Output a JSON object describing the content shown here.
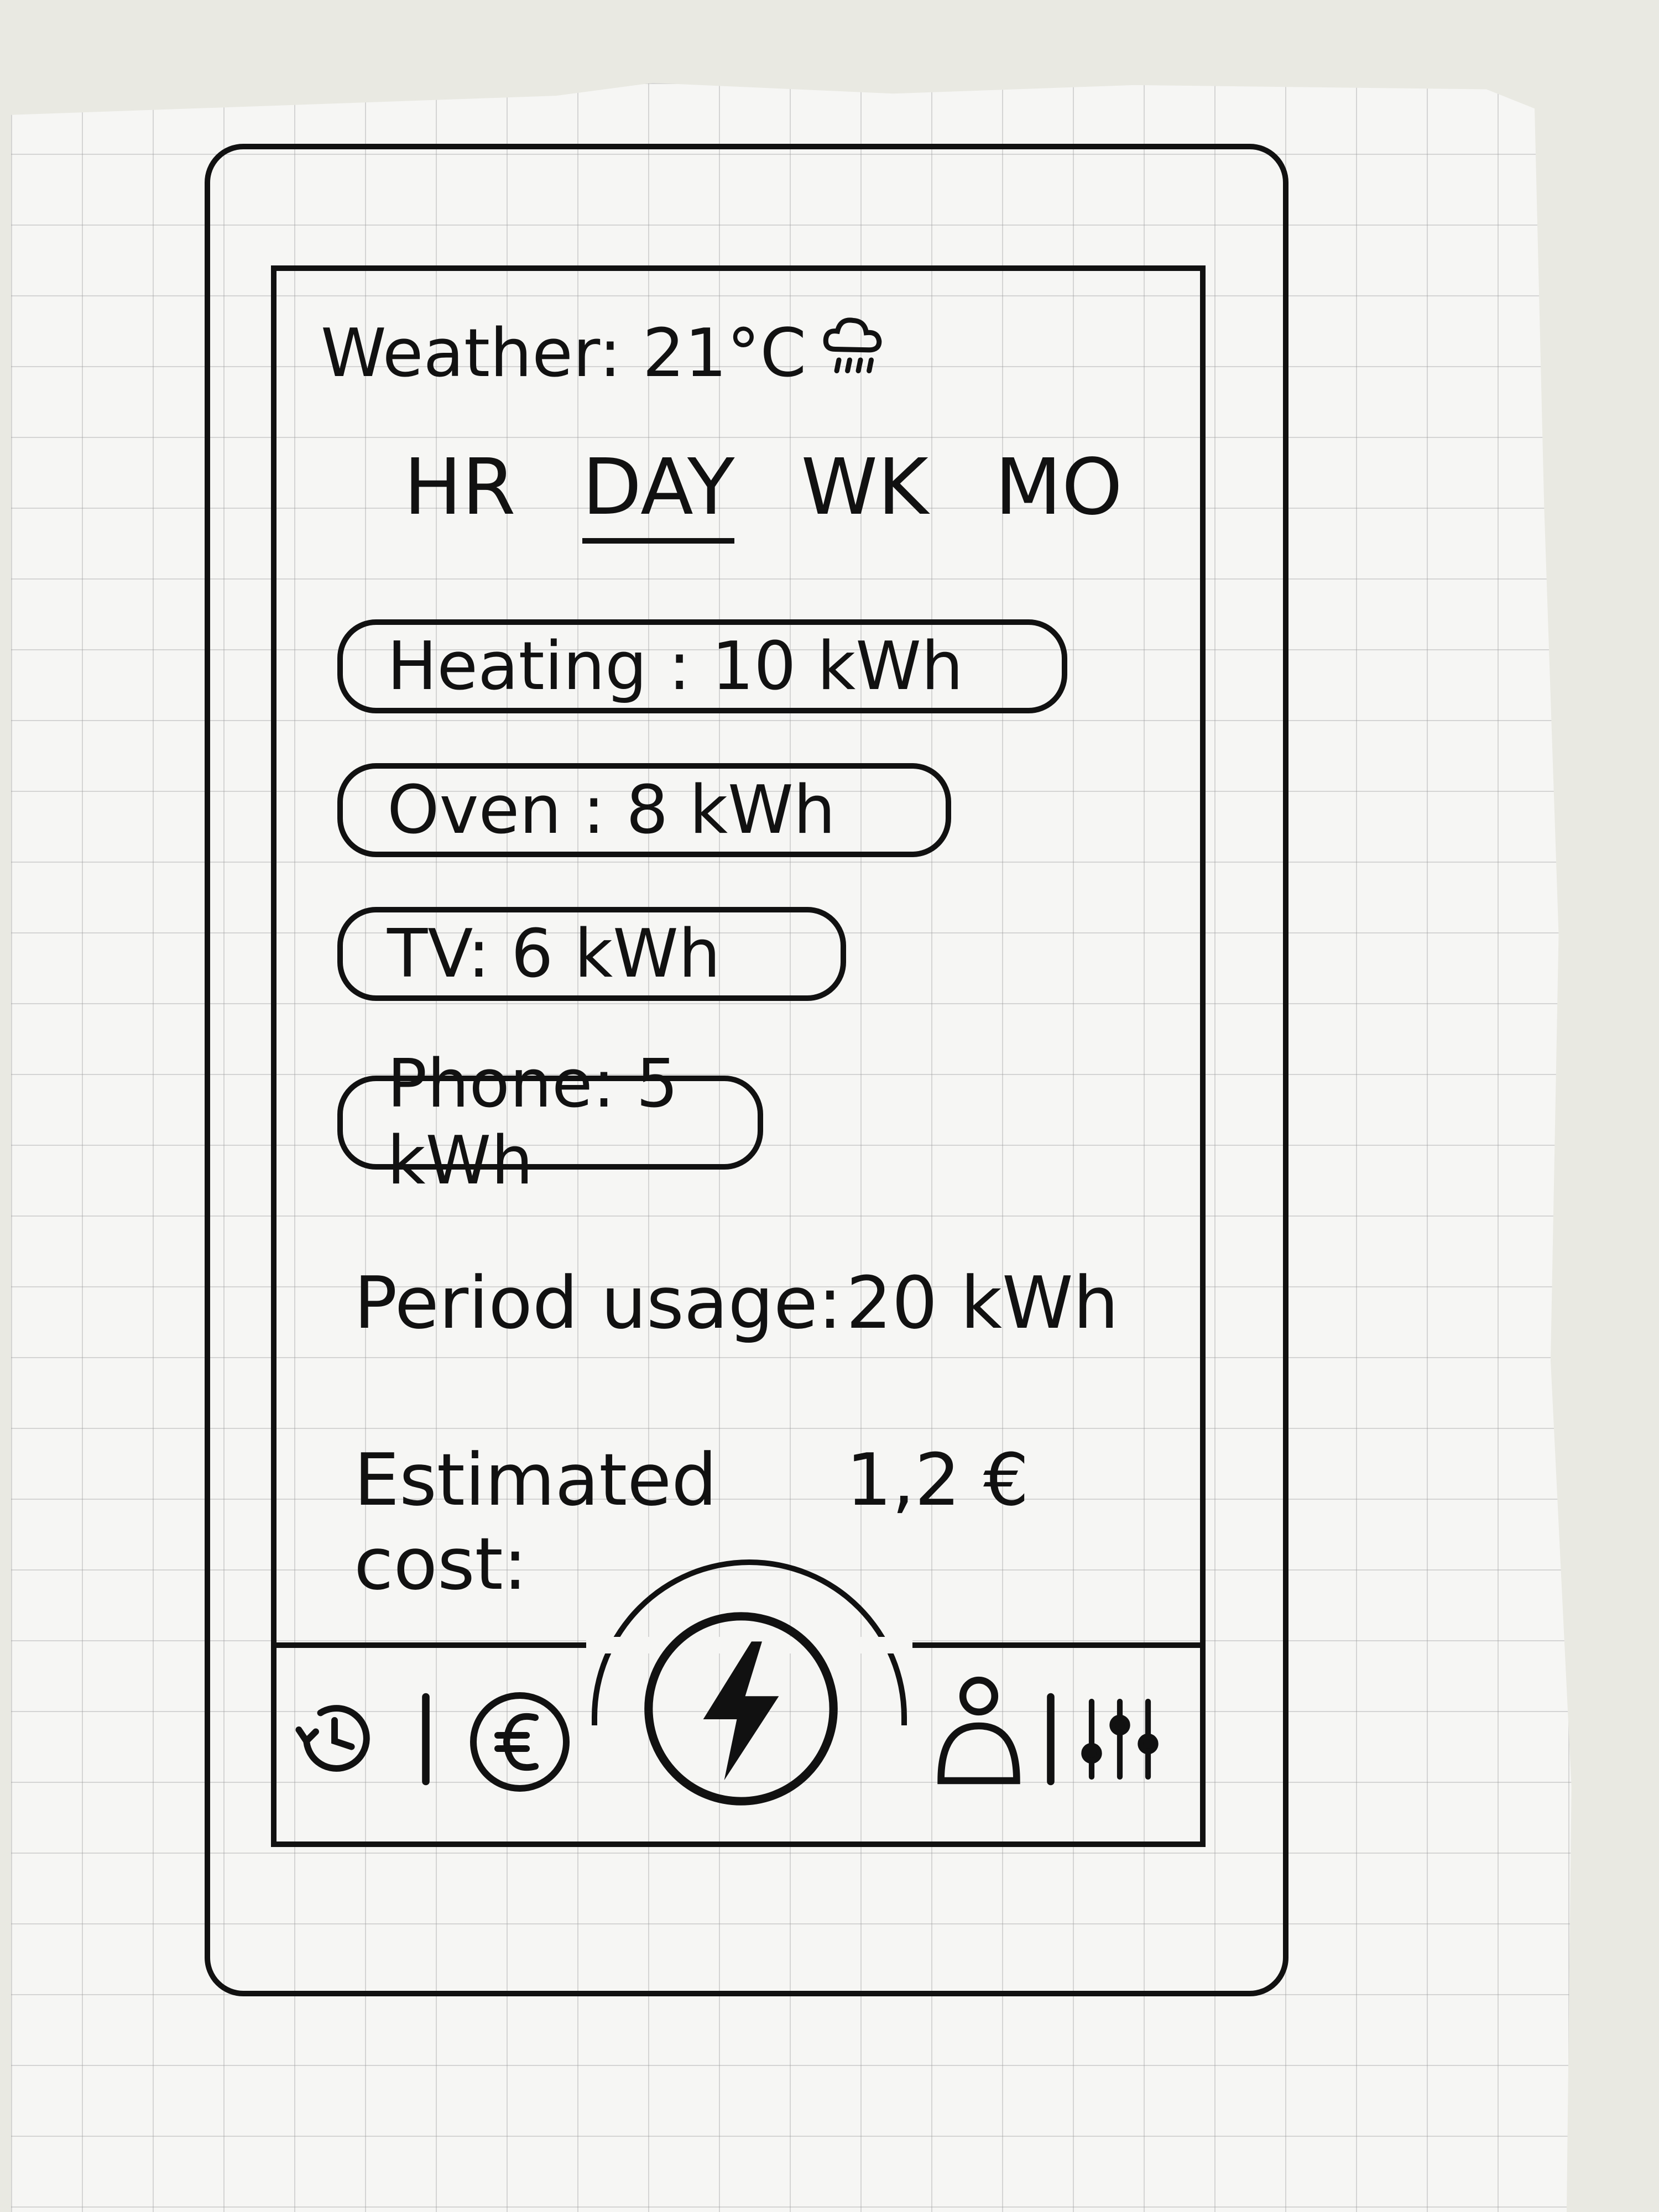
{
  "header": {
    "weather_label": "Weather: 21°C",
    "weather_icon": "cloud-rain-icon"
  },
  "tabs": [
    {
      "label": "HR",
      "active": false
    },
    {
      "label": "DAY",
      "active": true
    },
    {
      "label": "WK",
      "active": false
    },
    {
      "label": "MO",
      "active": false
    }
  ],
  "devices": [
    {
      "label": "Heating : 10 kWh"
    },
    {
      "label": "Oven : 8 kWh"
    },
    {
      "label": "TV: 6 kWh"
    },
    {
      "label": "Phone: 5 kWh"
    }
  ],
  "summary": {
    "period_label": "Period usage:",
    "period_value": "20 kWh",
    "cost_label": "Estimated cost:",
    "cost_value": "1,2 €"
  },
  "nav": {
    "items": [
      {
        "icon": "history-icon"
      },
      {
        "icon": "euro-icon"
      },
      {
        "icon": "lightning-icon"
      },
      {
        "icon": "user-icon"
      },
      {
        "icon": "sliders-icon"
      }
    ]
  }
}
